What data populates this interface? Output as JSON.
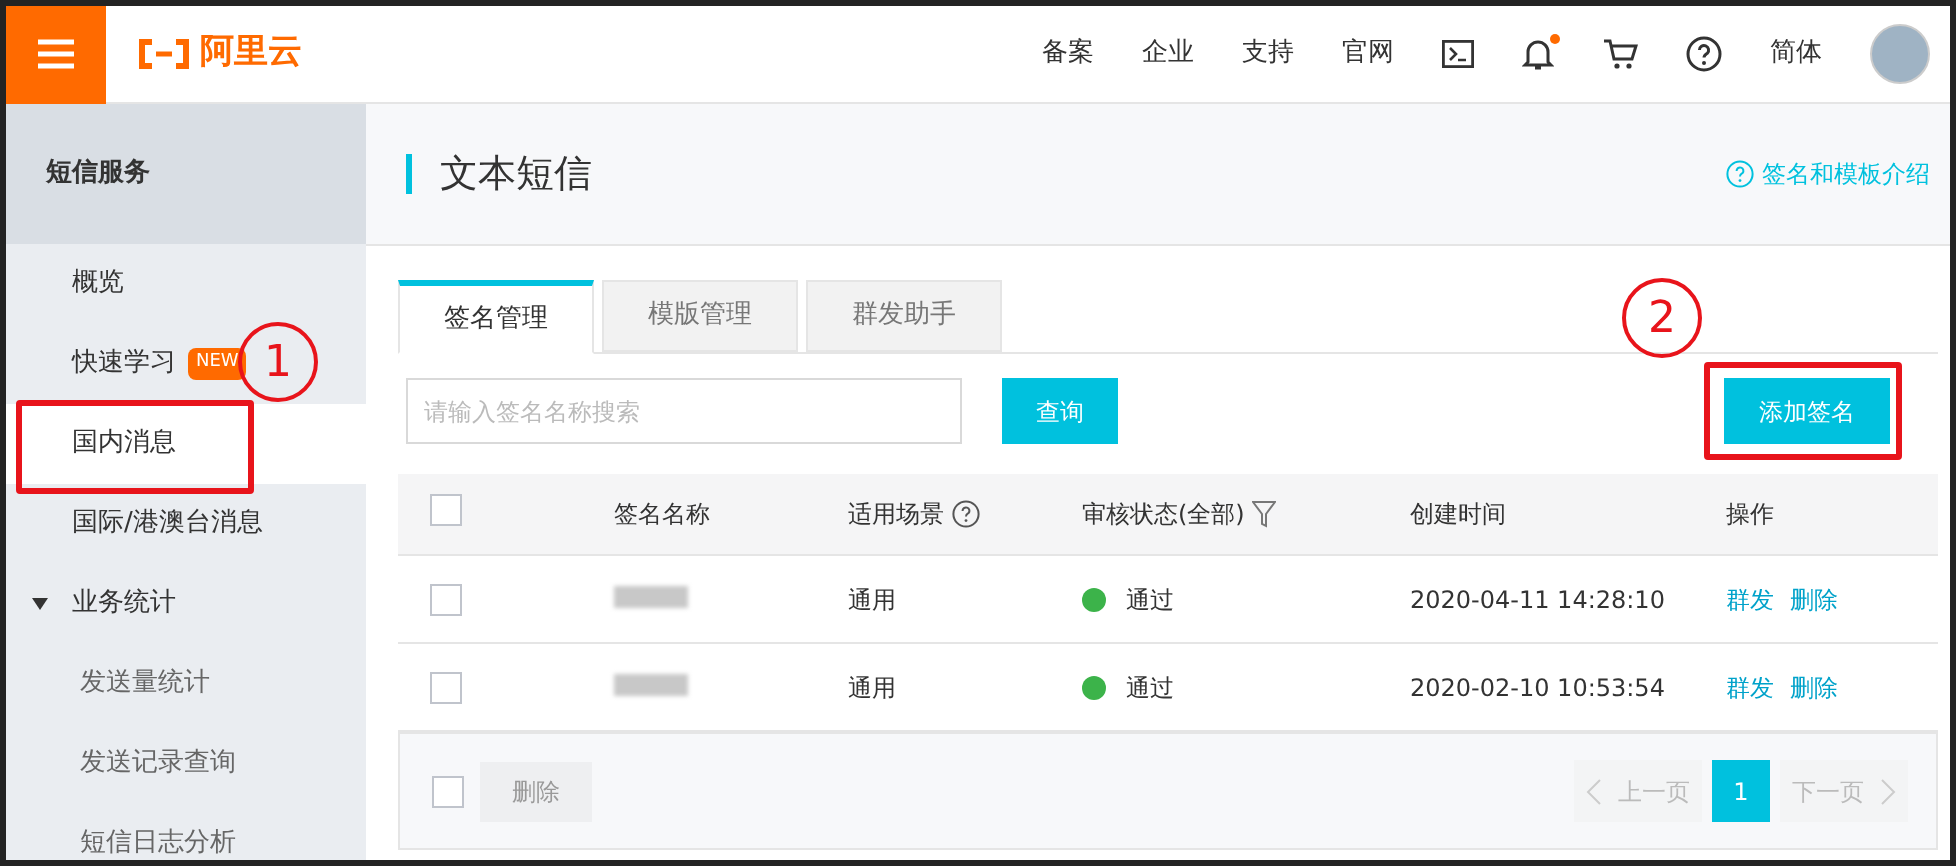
{
  "topbar": {
    "logo_text": "阿里云",
    "nav": [
      "备案",
      "企业",
      "支持",
      "官网"
    ],
    "notification_dot": true,
    "language": "简体"
  },
  "sidebar": {
    "title": "短信服务",
    "items": [
      {
        "label": "概览",
        "selected": false
      },
      {
        "label": "快速学习",
        "badge": "NEW",
        "selected": false
      },
      {
        "label": "国内消息",
        "selected": true
      },
      {
        "label": "国际/港澳台消息",
        "selected": false
      },
      {
        "label": "业务统计",
        "selected": false,
        "expanded": true,
        "children": [
          {
            "label": "发送量统计",
            "selected": false
          },
          {
            "label": "发送记录查询",
            "selected": false
          },
          {
            "label": "短信日志分析",
            "selected": false
          }
        ]
      }
    ]
  },
  "page": {
    "title": "文本短信",
    "help_link": "签名和模板介绍"
  },
  "tabs": [
    {
      "label": "签名管理",
      "selected": true
    },
    {
      "label": "模版管理",
      "selected": false
    },
    {
      "label": "群发助手",
      "selected": false
    }
  ],
  "search": {
    "placeholder": "请输入签名名称搜索",
    "button": "查询"
  },
  "add_button": "添加签名",
  "table": {
    "all_checked": false,
    "columns": [
      "签名名称",
      "适用场景",
      "审核状态(全部)",
      "创建时间",
      "操作"
    ],
    "rows": [
      {
        "checked": false,
        "scene": "通用",
        "status": "通过",
        "color": "#3cb34a",
        "created": "2020-04-11 14:28:10",
        "actions": [
          "群发",
          "删除"
        ]
      },
      {
        "checked": false,
        "scene": "通用",
        "status": "通过",
        "color": "#3cb34a",
        "created": "2020-02-10 10:53:54",
        "actions": [
          "群发",
          "删除"
        ]
      }
    ]
  },
  "footer": {
    "checked": false,
    "delete_button": "删除",
    "delete_disabled": true,
    "prev": "上一页",
    "next": "下一页",
    "pages": [
      {
        "label": "1",
        "selected": true
      }
    ]
  },
  "annotations": [
    {
      "label": "1"
    },
    {
      "label": "2"
    }
  ]
}
